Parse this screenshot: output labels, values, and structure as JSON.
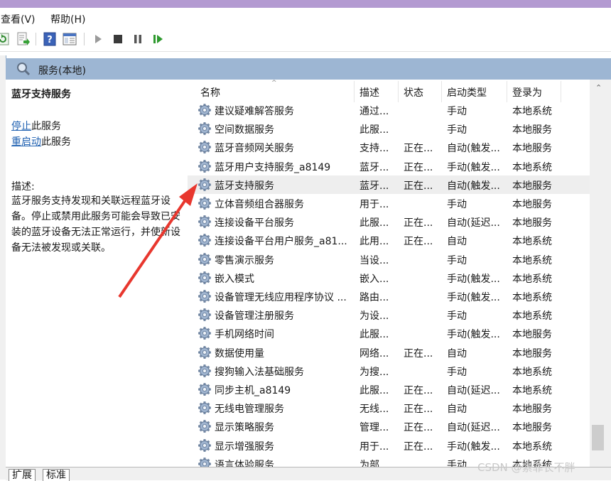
{
  "menu": {
    "view": "查看(V)",
    "help": "帮助(H)"
  },
  "toolbar": {
    "icons": [
      "refresh-icon",
      "export-list-icon",
      "help-icon",
      "properties-icon",
      "start-icon",
      "stop-icon",
      "pause-icon",
      "restart-icon"
    ]
  },
  "window": {
    "title": "服务(本地)"
  },
  "detail": {
    "service_name": "蓝牙支持服务",
    "stop_link": "停止",
    "stop_suffix": "此服务",
    "restart_link": "重启动",
    "restart_suffix": "此服务",
    "description_label": "描述:",
    "description": "蓝牙服务支持发现和关联远程蓝牙设备。停止或禁用此服务可能会导致已安装的蓝牙设备无法正常运行，并使新设备无法被发现或关联。"
  },
  "columns": {
    "name": "名称",
    "desc": "描述",
    "status": "状态",
    "startup": "启动类型",
    "logon": "登录为"
  },
  "rows": [
    {
      "name": "建议疑难解答服务",
      "desc": "通过...",
      "status": "",
      "startup": "手动",
      "logon": "本地系统"
    },
    {
      "name": "空间数据服务",
      "desc": "此服...",
      "status": "",
      "startup": "手动",
      "logon": "本地服务"
    },
    {
      "name": "蓝牙音频网关服务",
      "desc": "支持...",
      "status": "正在...",
      "startup": "自动(触发...",
      "logon": "本地服务"
    },
    {
      "name": "蓝牙用户支持服务_a8149",
      "desc": "蓝牙...",
      "status": "正在...",
      "startup": "手动(触发...",
      "logon": "本地系统"
    },
    {
      "name": "蓝牙支持服务",
      "desc": "蓝牙...",
      "status": "正在...",
      "startup": "自动(触发...",
      "logon": "本地服务"
    },
    {
      "name": "立体音频组合器服务",
      "desc": "用于...",
      "status": "",
      "startup": "手动",
      "logon": "本地服务"
    },
    {
      "name": "连接设备平台服务",
      "desc": "此服...",
      "status": "正在...",
      "startup": "自动(延迟...",
      "logon": "本地服务"
    },
    {
      "name": "连接设备平台用户服务_a81...",
      "desc": "此用...",
      "status": "正在...",
      "startup": "自动",
      "logon": "本地系统"
    },
    {
      "name": "零售演示服务",
      "desc": "当设...",
      "status": "",
      "startup": "手动",
      "logon": "本地系统"
    },
    {
      "name": "嵌入模式",
      "desc": "嵌入...",
      "status": "",
      "startup": "手动(触发...",
      "logon": "本地系统"
    },
    {
      "name": "设备管理无线应用程序协议 ...",
      "desc": "路由...",
      "status": "",
      "startup": "手动(触发...",
      "logon": "本地系统"
    },
    {
      "name": "设备管理注册服务",
      "desc": "为设...",
      "status": "",
      "startup": "手动",
      "logon": "本地系统"
    },
    {
      "name": "手机网络时间",
      "desc": "此服...",
      "status": "",
      "startup": "手动(触发...",
      "logon": "本地服务"
    },
    {
      "name": "数据使用量",
      "desc": "网络...",
      "status": "正在...",
      "startup": "自动",
      "logon": "本地服务"
    },
    {
      "name": "搜狗输入法基础服务",
      "desc": "为搜...",
      "status": "",
      "startup": "手动",
      "logon": "本地系统"
    },
    {
      "name": "同步主机_a8149",
      "desc": "此服...",
      "status": "正在...",
      "startup": "自动(延迟...",
      "logon": "本地系统"
    },
    {
      "name": "无线电管理服务",
      "desc": "无线...",
      "status": "正在...",
      "startup": "自动",
      "logon": "本地服务"
    },
    {
      "name": "显示策略服务",
      "desc": "管理...",
      "status": "正在...",
      "startup": "自动(延迟...",
      "logon": "本地服务"
    },
    {
      "name": "显示增强服务",
      "desc": "用于...",
      "status": "正在...",
      "startup": "手动(触发...",
      "logon": "本地系统"
    },
    {
      "name": "语言体验服务",
      "desc": "为部...",
      "status": "",
      "startup": "手动",
      "logon": "本地系统"
    }
  ],
  "tabs": {
    "extended": "扩展",
    "standard": "标准"
  },
  "watermark": "CSDN @索菲长不胖"
}
